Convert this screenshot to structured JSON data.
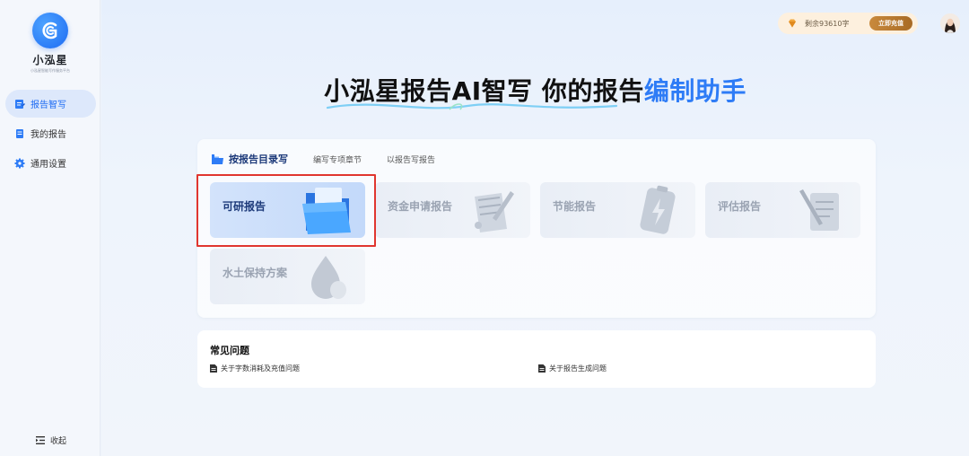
{
  "brand": {
    "name": "小泓星",
    "tagline": "小泓星智能写作服务平台"
  },
  "sidebar": {
    "items": [
      {
        "label": "报告智写",
        "icon": "report-write-icon",
        "active": true
      },
      {
        "label": "我的报告",
        "icon": "document-icon",
        "active": false
      },
      {
        "label": "通用设置",
        "icon": "gear-icon",
        "active": false
      }
    ],
    "collapse_label": "收起"
  },
  "topbar": {
    "balance": "剩余93610字",
    "recharge_label": "立即充值"
  },
  "hero": {
    "title_main": "小泓星报告AI智写 你的报告",
    "title_accent": "编制助手"
  },
  "tabs": [
    {
      "label": "按报告目录写",
      "active": true
    },
    {
      "label": "编写专项章节",
      "active": false
    },
    {
      "label": "以报告写报告",
      "active": false
    }
  ],
  "report_types": [
    {
      "label": "可研报告",
      "active": true
    },
    {
      "label": "资金申请报告",
      "active": false
    },
    {
      "label": "节能报告",
      "active": false
    },
    {
      "label": "评估报告",
      "active": false
    },
    {
      "label": "水土保持方案",
      "active": false
    }
  ],
  "faq": {
    "title": "常见问题",
    "items": [
      "关于字数消耗及充值问题",
      "关于报告生成问题"
    ]
  },
  "colors": {
    "accent": "#2e7cf6",
    "highlight_border": "#e0362f",
    "recharge": "#b87a30"
  }
}
